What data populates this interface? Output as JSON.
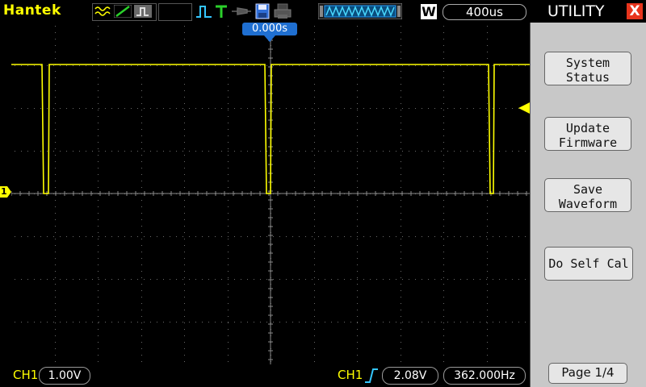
{
  "app": {
    "brand": "Hantek"
  },
  "toolbar": {
    "icons": [
      "waveform-icon",
      "ramp-icon",
      "persistence-icon",
      "pulse-icon",
      "trigger-T-icon",
      "probe-icon",
      "save-disk-icon",
      "print-icon"
    ],
    "memory_mode": "W",
    "timebase": "400us"
  },
  "trigger": {
    "position": "0.000s"
  },
  "channel": {
    "ch1_marker": "1"
  },
  "bottom": {
    "ch1_label": "CH1",
    "ch1_scale": "1.00V",
    "trig_src": "CH1",
    "trig_level": "2.08V",
    "frequency": "362.000Hz"
  },
  "panel": {
    "title": "UTILITY",
    "close_label": "X",
    "buttons": [
      "System\nStatus",
      "Update\nFirmware",
      "Save\nWaveform",
      "Do Self Cal"
    ],
    "page": "Page 1/4"
  },
  "colors": {
    "trace": "#ffff00",
    "accent": "#1f6fd1",
    "close": "#e8341c"
  }
}
